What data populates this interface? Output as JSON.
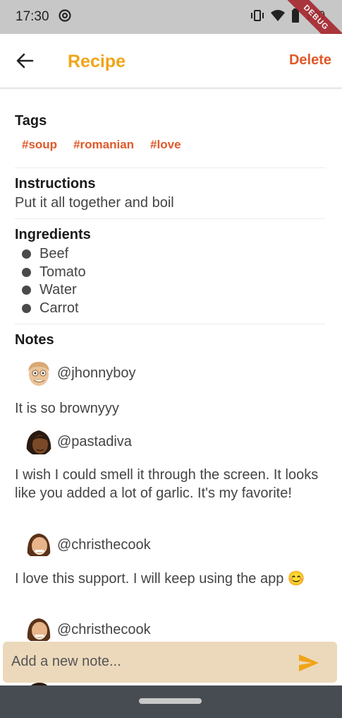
{
  "status_bar": {
    "time": "17:30",
    "battery_text": "100",
    "debug_label": "DEBUG"
  },
  "app_bar": {
    "title": "Recipe",
    "delete_label": "Delete",
    "title_color": "#f0a418",
    "accent_color": "#e0592a"
  },
  "tags": {
    "title": "Tags",
    "items": [
      "#soup",
      "#romanian",
      "#love"
    ]
  },
  "instructions": {
    "title": "Instructions",
    "text": "Put it all together and boil"
  },
  "ingredients": {
    "title": "Ingredients",
    "items": [
      "Beef",
      "Tomato",
      "Water",
      "Carrot"
    ]
  },
  "notes": {
    "title": "Notes",
    "items": [
      {
        "username": "@jhonnyboy",
        "avatar": "avatar-old-man",
        "text": "It is so brownyyy"
      },
      {
        "username": "@pastadiva",
        "avatar": "avatar-woman",
        "text": "I wish I could smell it through the screen. It looks like you added a lot of garlic. It's my favorite!"
      },
      {
        "username": "@christhecook",
        "avatar": "avatar-bearded-man",
        "text": "I love this support. I will keep using the app 😊"
      },
      {
        "username": "@christhecook",
        "avatar": "avatar-bearded-man",
        "text": ""
      }
    ]
  },
  "composer": {
    "placeholder": "Add a new note...",
    "send_icon": "send-icon",
    "background": "#ecd9bc",
    "send_color": "#f0a418"
  }
}
